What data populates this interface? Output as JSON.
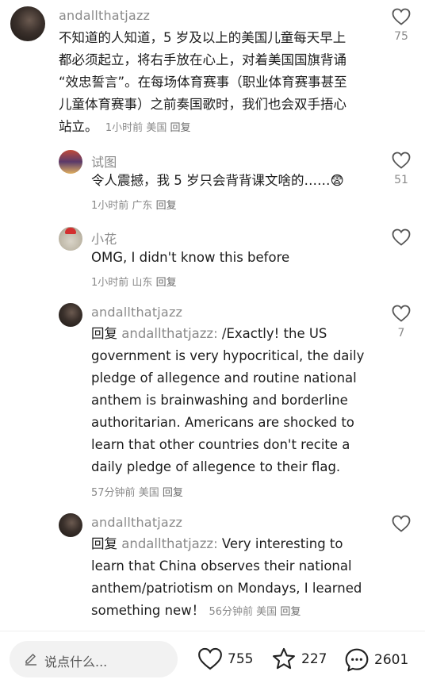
{
  "comments": [
    {
      "username": "andallthatjazz",
      "text": "不知道的人知道，5 岁及以上的美国儿童每天早上都必须起立，将右手放在心上，对着美国国旗背诵“效忠誓言”。在每场体育赛事（职业体育赛事甚至儿童体育赛事）之前奏国歌时，我们也会双手捂心站立。",
      "lines": [
        "不知道的人知道，5 岁及以上的美国儿童每天早上",
        "都必须起立，将右手放在心上，对着美国国旗背诵",
        "“效忠誓言”。在每场体育赛事（职业体育赛事甚至",
        "儿童体育赛事）之前奏国歌时，我们也会双手捂心",
        "站立。"
      ],
      "time": "1小时前",
      "location": "美国",
      "reply": "回复",
      "likes": "75"
    },
    {
      "username": "试图",
      "text": "令人震撼，我 5 岁只会背背课文啥的……😨",
      "time": "1小时前",
      "location": "广东",
      "reply": "回复",
      "likes": "51"
    },
    {
      "username": "小花",
      "text": "OMG, I didn't know this before",
      "time": "1小时前",
      "location": "山东",
      "reply": "回复",
      "likes": ""
    },
    {
      "username": "andallthatjazz",
      "reply_prefix": "回复",
      "reply_to": "andallthatjazz:",
      "lines": [
        "/Exactly! the US",
        "government is very hypocritical, the daily",
        "pledge of allegence and routine national",
        "anthem is brainwashing and borderline",
        "authoritarian. Americans are shocked to",
        "learn that other countries don't recite a",
        "daily pledge of allegence to their flag."
      ],
      "time": "57分钟前",
      "location": "美国",
      "reply": "回复",
      "likes": "7"
    },
    {
      "username": "andallthatjazz",
      "reply_prefix": "回复",
      "reply_to": "andallthatjazz:",
      "lines": [
        "Very interesting to",
        "learn that China observes their national",
        "anthem/patriotism on Mondays, I learned",
        "something new！"
      ],
      "time": "56分钟前",
      "location": "美国",
      "reply": "回复",
      "likes": ""
    }
  ],
  "bottom_bar": {
    "placeholder": "说点什么...",
    "likes": "755",
    "favorites": "227",
    "comments": "2601",
    "icons": [
      "pencil-icon",
      "heart-icon",
      "star-icon",
      "comment-icon"
    ]
  }
}
